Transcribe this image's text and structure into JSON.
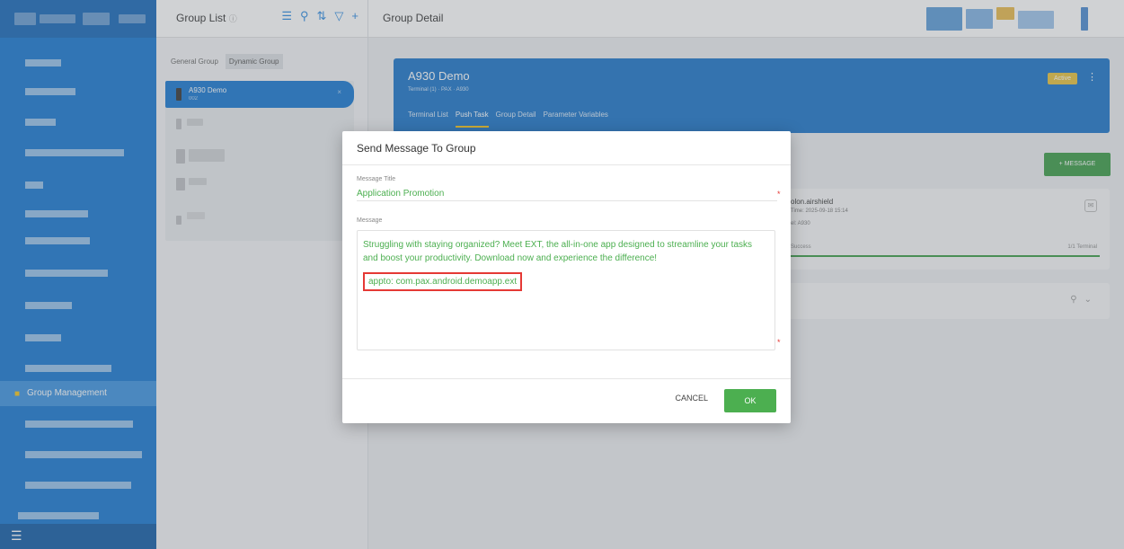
{
  "sidebar": {
    "active_item_label": "Group Management",
    "active_item_icon": "folder-icon",
    "menu_icon": "☰"
  },
  "group_list": {
    "title": "Group List",
    "tabs": [
      "General Group",
      "Dynamic Group"
    ],
    "selected_tab": "Dynamic Group",
    "selected_group": {
      "name": "A930 Demo",
      "sub": "002"
    }
  },
  "group_detail": {
    "header_title": "Group Detail",
    "banner": {
      "name": "A930 Demo",
      "subtitle": "Terminal (1) · PAX · A930",
      "status_badge": "Active",
      "tabs": [
        "Terminal List",
        "Push Task",
        "Group Detail",
        "Parameter Variables"
      ],
      "active_tab": "Push Task"
    },
    "add_message_label": "+ MESSAGE",
    "task": {
      "name": "olon.airshield",
      "time": "Time: 2025-09-18 15:14",
      "model": "el: A930",
      "status": "Success",
      "count": "1/1 Terminal"
    }
  },
  "modal": {
    "title": "Send Message To Group",
    "title_label": "Message Title",
    "title_value": "Application Promotion",
    "message_label": "Message",
    "message_text": "Struggling with staying organized? Meet EXT, the all-in-one app designed to streamline your tasks and boost your productivity. Download now and experience the difference!",
    "message_appto": "appto: com.pax.android.demoapp.ext",
    "cancel_label": "CANCEL",
    "ok_label": "OK"
  },
  "colors": {
    "nav_blue": "#1677d2",
    "banner_blue": "#1a74c9",
    "ok_green": "#4caf50",
    "highlight_red": "#e53935"
  }
}
